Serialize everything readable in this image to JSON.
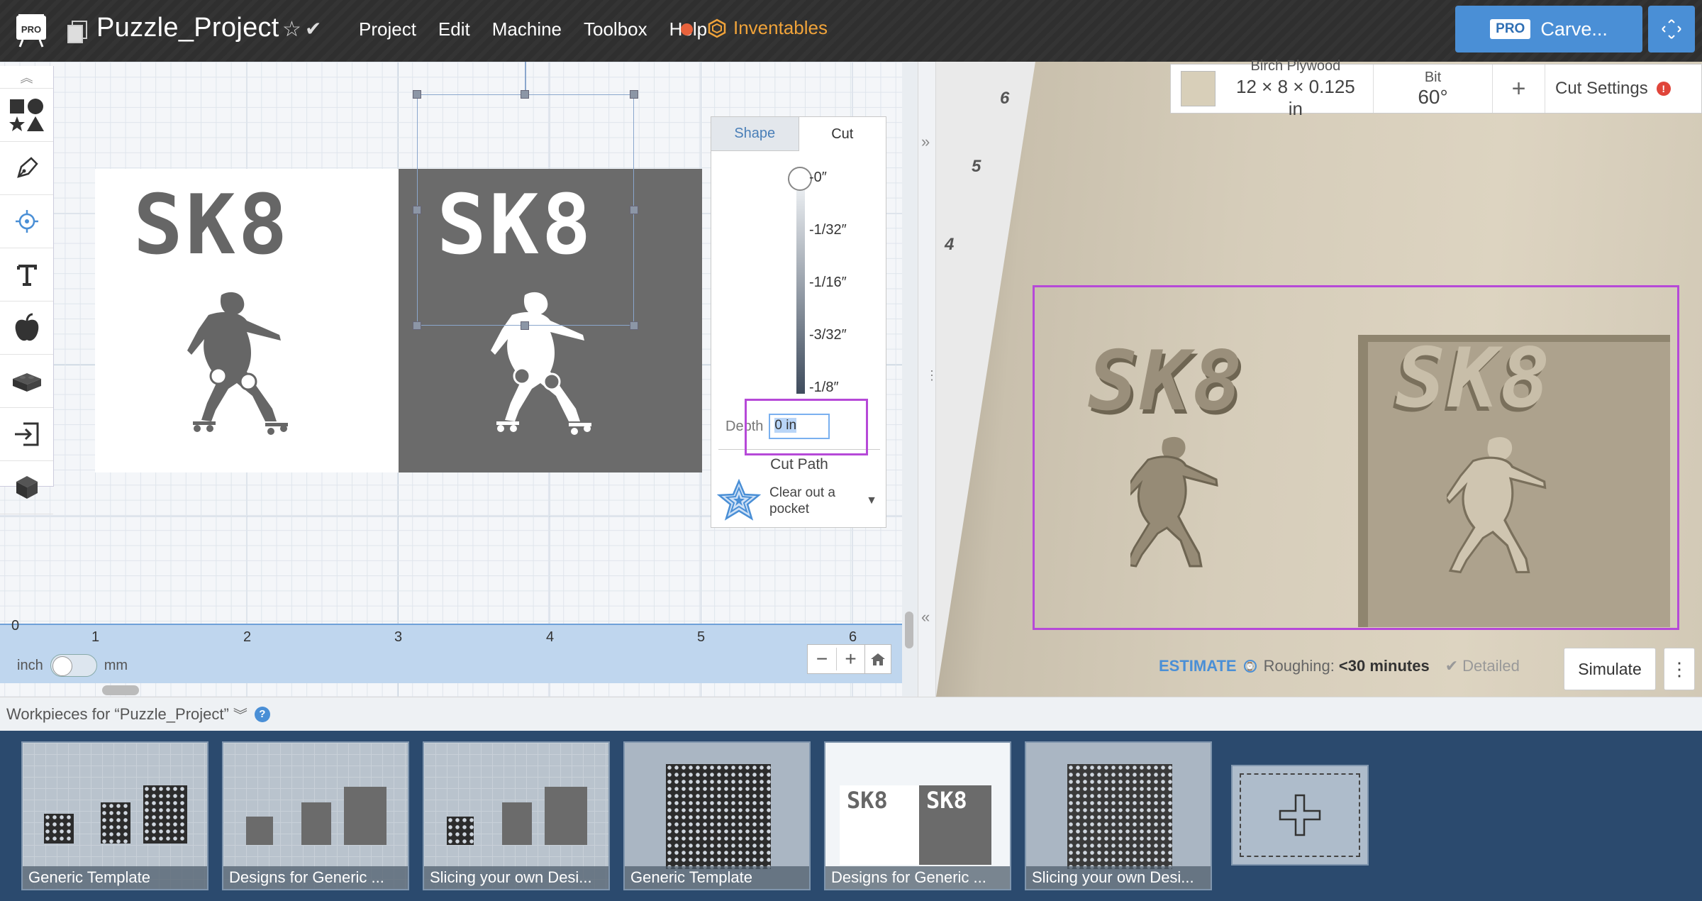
{
  "app": {
    "logo_text": "PRO",
    "project_title": "Puzzle_Project",
    "menu": [
      "Project",
      "Edit",
      "Machine",
      "Toolbox",
      "Help"
    ],
    "inventables_label": "Inventables",
    "carve_badge": "PRO",
    "carve_label": "Carve..."
  },
  "design": {
    "workpiece_text": "SK8",
    "ruler_labels": [
      "0",
      "1",
      "2",
      "3",
      "4",
      "5",
      "6"
    ],
    "unit_inch": "inch",
    "unit_mm": "mm"
  },
  "cut_panel": {
    "tab_shape": "Shape",
    "tab_cut": "Cut",
    "depth_marks": [
      "-0″",
      "-1/32″",
      "-1/16″",
      "-3/32″",
      "-1/8″"
    ],
    "depth_label": "Depth",
    "depth_value": "0 in",
    "cut_path_label": "Cut Path",
    "cut_path_value": "Clear out a pocket"
  },
  "preview": {
    "material_name": "Birch Plywood",
    "material_size": "12 × 8 × 0.125 in",
    "bit_label": "Bit",
    "bit_value": "60°",
    "cut_settings_label": "Cut Settings",
    "axis_numbers": [
      "6",
      "5",
      "4"
    ],
    "estimate_label": "ESTIMATE",
    "roughing_label": "Roughing:",
    "roughing_value": "<30 minutes",
    "detailed_label": "Detailed",
    "simulate_label": "Simulate",
    "carved_text": "SK8"
  },
  "workpieces": {
    "header": "Workpieces for “Puzzle_Project”",
    "items": [
      {
        "label": "Generic Template"
      },
      {
        "label": "Designs for Generic ..."
      },
      {
        "label": "Slicing your own Desi..."
      },
      {
        "label": "Generic Template"
      },
      {
        "label": "Designs for Generic ..."
      },
      {
        "label": "Slicing your own Desi..."
      }
    ]
  },
  "colors": {
    "accent_blue": "#4a8fd6",
    "highlight_purple": "#b649d8",
    "inventables_orange": "#f0a33a",
    "record_dot": "#e8623c"
  }
}
